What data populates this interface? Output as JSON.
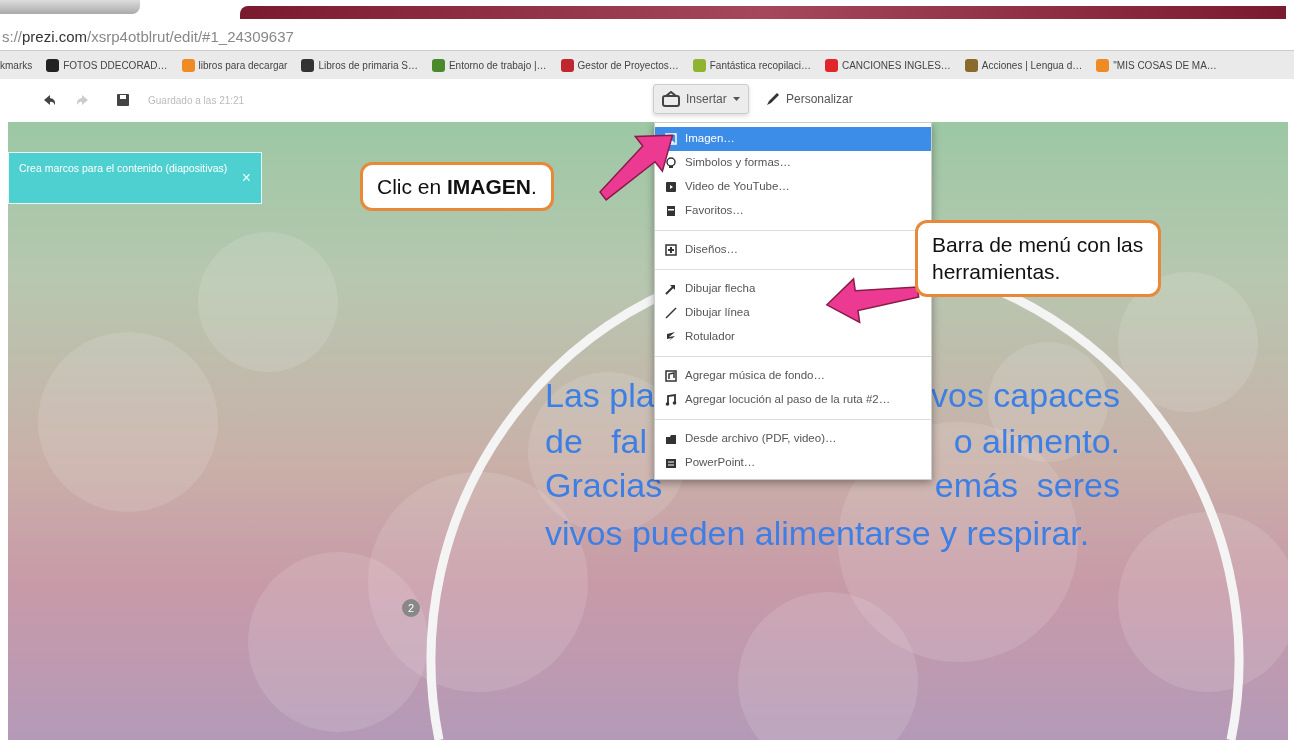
{
  "address_bar": {
    "scheme": "s://",
    "domain": "prezi.com",
    "path": "/xsrp4otblrut/edit/#1_24309637"
  },
  "bookmarks_bar": {
    "label": "kmarks",
    "items": [
      {
        "label": "FOTOS DDECORAD…",
        "color": "#222222"
      },
      {
        "label": "libros para decargar",
        "color": "#f08a24"
      },
      {
        "label": "Libros de primaria S…",
        "color": "#333333"
      },
      {
        "label": "Entorno de trabajo |…",
        "color": "#4a8a2a"
      },
      {
        "label": "Gestor de Proyectos…",
        "color": "#c0262d"
      },
      {
        "label": "Fantástica recopilaci…",
        "color": "#8fb530"
      },
      {
        "label": "CANCIONES INGLES…",
        "color": "#e0262a"
      },
      {
        "label": "Acciones | Lengua d…",
        "color": "#8a6a2a"
      },
      {
        "label": "\"MIS COSAS DE MA…",
        "color": "#f08a24"
      }
    ]
  },
  "toolbar": {
    "undo_disabled": false,
    "redo_disabled": true,
    "save_status": "Guardado a las 21:21",
    "insert_button": {
      "label": "Insertar",
      "expanded": true
    },
    "customize_button": {
      "label": "Personalizar"
    }
  },
  "insert_menu": {
    "groups": [
      [
        {
          "label": "Imagen…",
          "selected": true
        },
        {
          "label": "Simbolos y formas…",
          "selected": false
        },
        {
          "label": "Video de YouTube…",
          "selected": false
        },
        {
          "label": "Favoritos…",
          "selected": false
        }
      ],
      [
        {
          "label": "Diseños…",
          "selected": false
        }
      ],
      [
        {
          "label": "Dibujar flecha",
          "selected": false
        },
        {
          "label": "Dibujar línea",
          "selected": false
        },
        {
          "label": "Rotulador",
          "selected": false
        }
      ],
      [
        {
          "label": "Agregar música de fondo…",
          "selected": false
        },
        {
          "label": "Agregar locución al paso de la ruta #2…",
          "selected": false
        }
      ],
      [
        {
          "label": "Desde archivo (PDF, video)…",
          "selected": false
        },
        {
          "label": "PowerPoint…",
          "selected": false
        }
      ]
    ]
  },
  "notification": {
    "text": "Crea marcos para el contenido (diapositivas)",
    "close": "×"
  },
  "slide_text": {
    "lines": [
      {
        "left": "Las pla",
        "right": "vos capaces"
      },
      {
        "left": "de   fal",
        "right": "o alimento."
      },
      {
        "left": "Gracias",
        "right": "emás  seres"
      },
      {
        "left": "vivos pueden alimentarse y respirar."
      }
    ]
  },
  "path_step": "2",
  "callouts": [
    {
      "text": "Clic en **IMAGEN**."
    },
    {
      "text": "Barra de menú con las herramientas."
    }
  ]
}
